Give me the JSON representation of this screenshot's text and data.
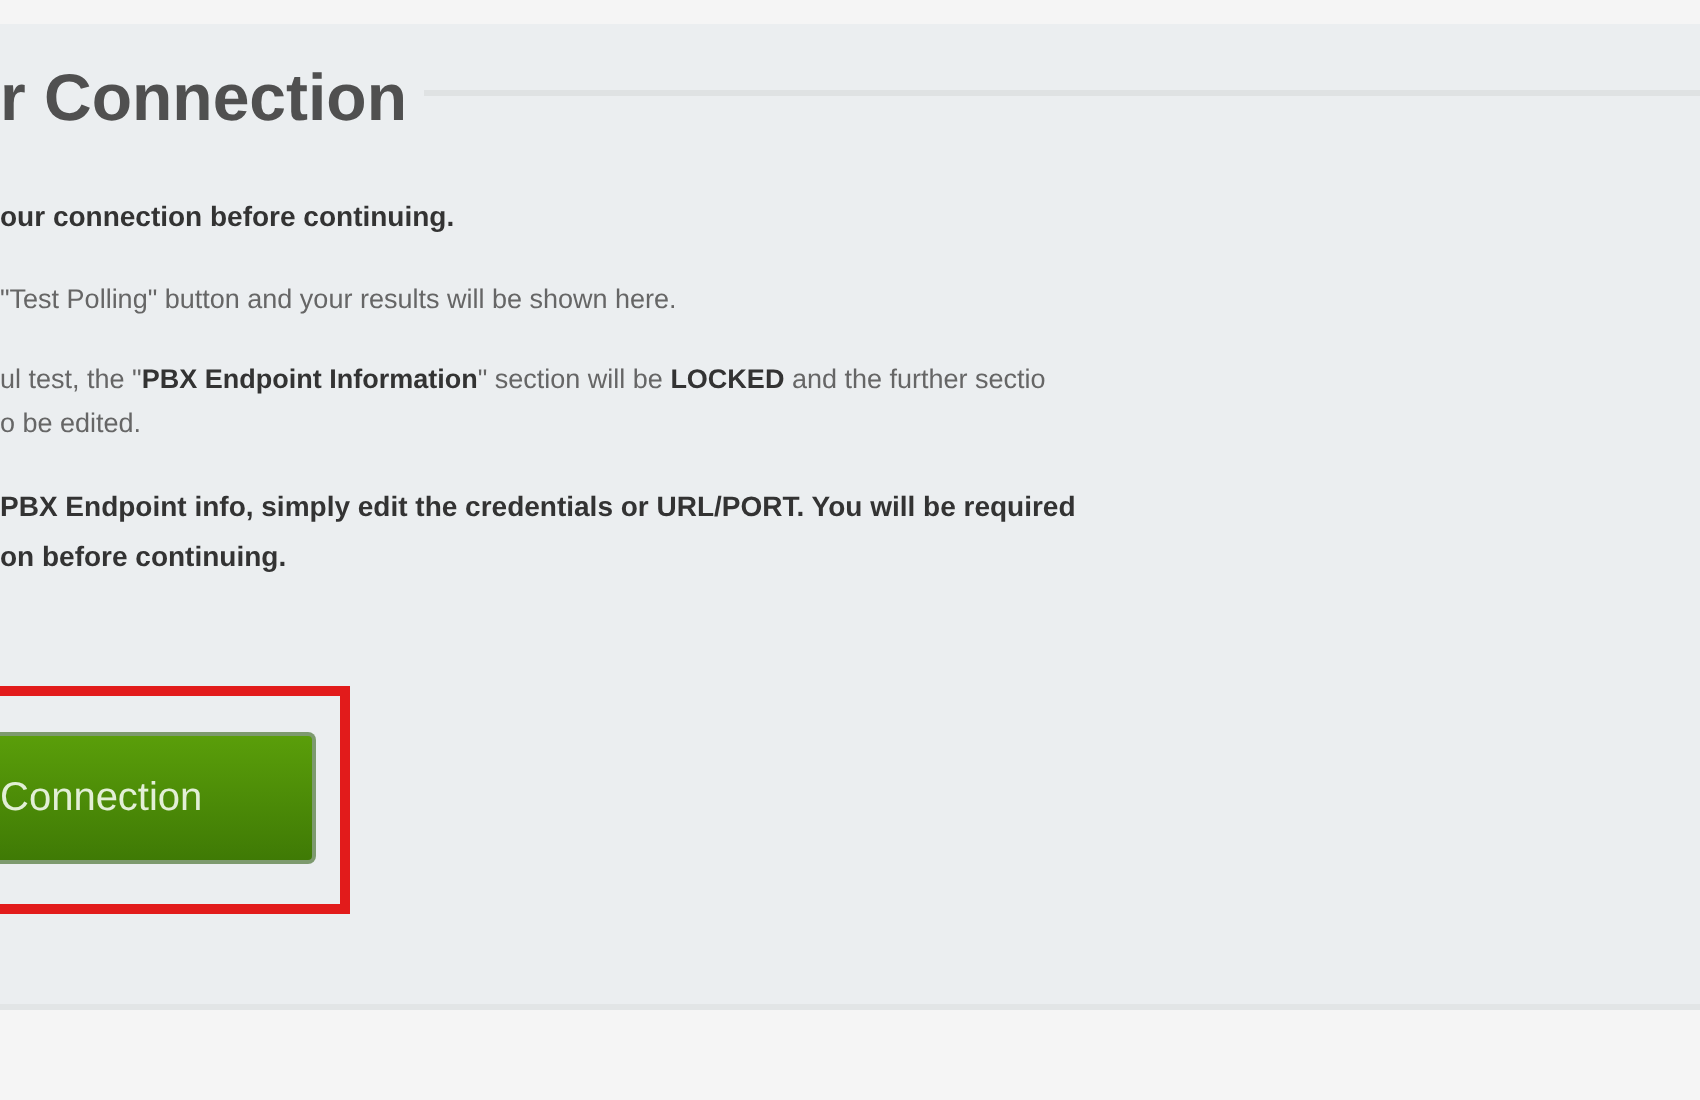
{
  "section": {
    "title": "r Connection",
    "paragraphs": [
      {
        "kind": "strong",
        "text": "our connection before continuing."
      },
      {
        "kind": "plain",
        "text": "\"Test Polling\" button and your results will be shown here."
      },
      {
        "kind": "plain",
        "text": "ul test, the \"**PBX Endpoint Information**\" section will be **LOCKED** and the further sectio\no be edited."
      },
      {
        "kind": "strong",
        "text": "PBX Endpoint info, simply edit the credentials or URL/PORT. You will be required\non before continuing."
      }
    ],
    "button": {
      "label": "Connection",
      "highlighted": true
    }
  }
}
